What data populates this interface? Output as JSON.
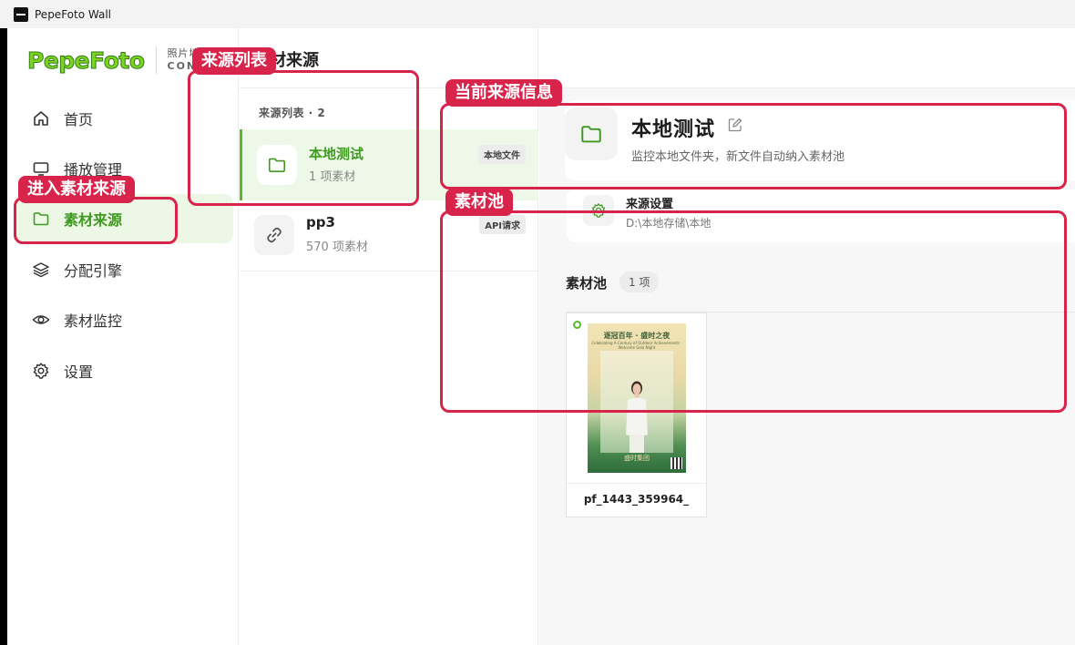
{
  "window": {
    "title": "PepeFoto Wall"
  },
  "logo": {
    "text": "PepeFoto",
    "sub_cn": "照片墙",
    "sub_en": "CONSO"
  },
  "sidebar": {
    "items": [
      {
        "label": "首页",
        "icon": "home-icon"
      },
      {
        "label": "播放管理",
        "icon": "monitor-icon"
      },
      {
        "label": "素材来源",
        "icon": "folder-icon",
        "active": true
      },
      {
        "label": "分配引擎",
        "icon": "layers-icon"
      },
      {
        "label": "素材监控",
        "icon": "eye-icon"
      },
      {
        "label": "设置",
        "icon": "gear-icon"
      }
    ]
  },
  "page": {
    "title": "材来源"
  },
  "sources": {
    "header": "来源列表 · 2",
    "items": [
      {
        "name": "本地测试",
        "count": "1 项素材",
        "badge": "本地文件",
        "icon": "folder-icon",
        "active": true
      },
      {
        "name": "pp3",
        "count": "570 项素材",
        "badge": "API请求",
        "icon": "link-icon",
        "active": false
      }
    ]
  },
  "current_source": {
    "title": "本地测试",
    "description": "监控本地文件夹，新文件自动纳入素材池",
    "settings": {
      "title": "来源设置",
      "path": "D:\\本地存储\\本地"
    }
  },
  "pool": {
    "title": "素材池",
    "count": "1 项",
    "items": [
      {
        "filename": "pf_1443_359964_",
        "poster_title": "逐冠百年 · 盛时之夜",
        "poster_sub": "Celebrating A Century of Outdoor Achievements · Welcome Gala Night",
        "poster_logo": "盛时集团"
      }
    ]
  },
  "annotations": {
    "source_list": "来源列表",
    "enter_sources": "进入素材来源",
    "current_info": "当前来源信息",
    "pool": "素材池"
  },
  "colors": {
    "accent": "#5cb82b",
    "accent_text": "#3f9a20",
    "annotation": "#d8234a"
  }
}
